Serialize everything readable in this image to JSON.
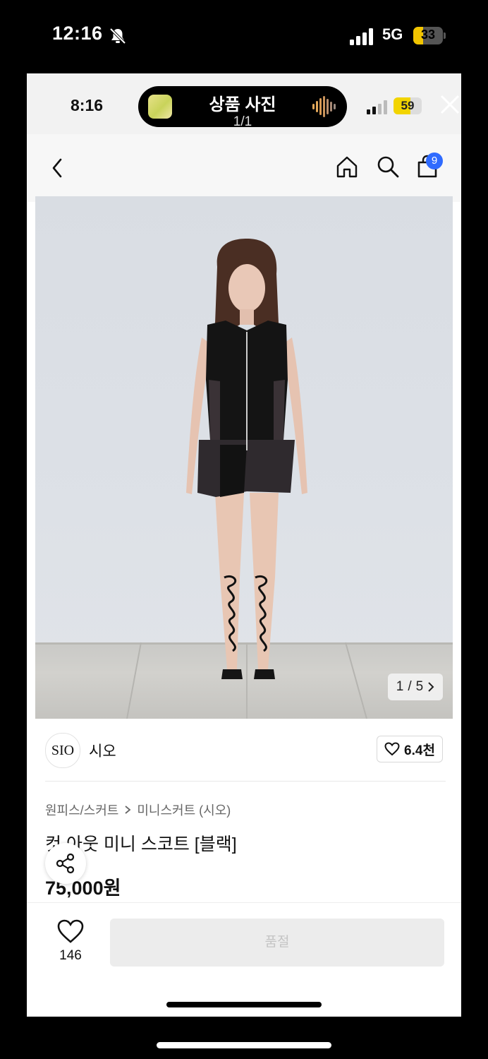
{
  "os_status": {
    "time": "12:16",
    "network": "5G",
    "battery": "33",
    "battery_level_pct": 33
  },
  "inner_status": {
    "time": "8:16",
    "battery": "59",
    "battery_level_pct": 59
  },
  "viewer": {
    "title": "상품 사진",
    "counter": "1/1"
  },
  "nav": {
    "cart_count": "9"
  },
  "gallery": {
    "current": "1",
    "separator": "/",
    "total": "5"
  },
  "seller": {
    "logo_text": "SIO",
    "name": "시오",
    "likes": "6.4천"
  },
  "product": {
    "breadcrumb": [
      "원피스/스커트",
      "미니스커트 (시오)"
    ],
    "name": "컷 아웃 미니 스코트 [블랙]",
    "price": "75,000원"
  },
  "actions": {
    "wish_count": "146",
    "buy_label": "품절"
  }
}
